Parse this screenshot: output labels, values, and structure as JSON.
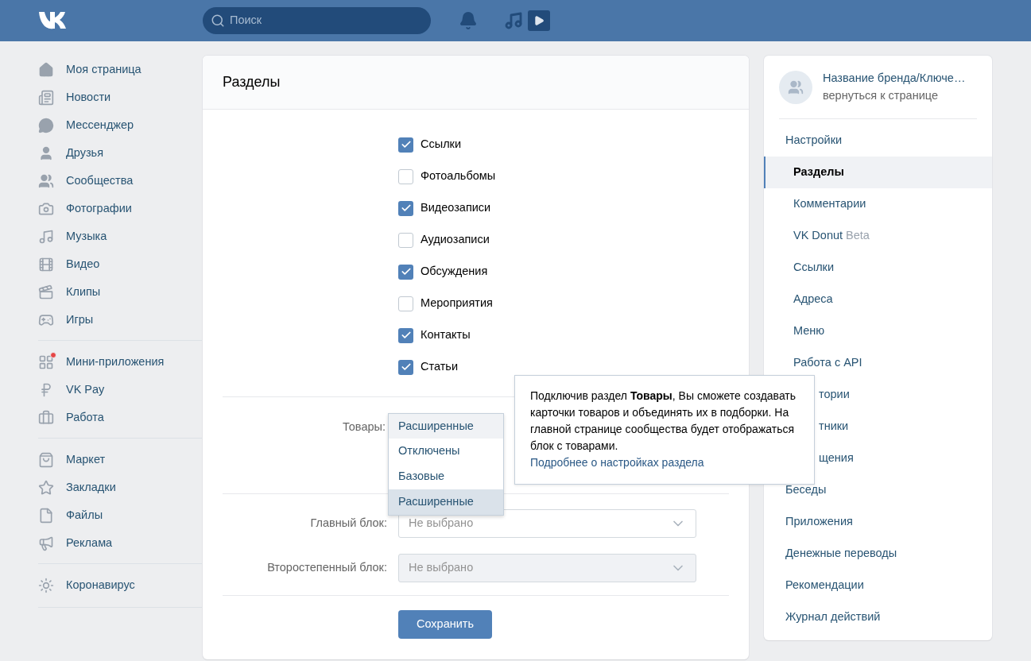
{
  "header": {
    "search": {
      "placeholder": "Поиск"
    }
  },
  "nav": [
    [
      {
        "label": "Моя страница"
      },
      {
        "label": "Новости"
      },
      {
        "label": "Мессенджер"
      },
      {
        "label": "Друзья"
      },
      {
        "label": "Сообщества"
      },
      {
        "label": "Фотографии"
      },
      {
        "label": "Музыка"
      },
      {
        "label": "Видео"
      },
      {
        "label": "Клипы"
      },
      {
        "label": "Игры"
      }
    ],
    [
      {
        "label": "Мини-приложения",
        "notification": true
      },
      {
        "label": "VK Pay",
        "notification": false
      },
      {
        "label": "Работа",
        "notification": false
      }
    ],
    [
      {
        "label": "Маркет"
      },
      {
        "label": "Закладки"
      },
      {
        "label": "Файлы"
      },
      {
        "label": "Реклама"
      }
    ],
    [
      {
        "label": "Коронавирус"
      }
    ]
  ],
  "main": {
    "title": "Разделы",
    "sections": [
      {
        "label": "Ссылки",
        "checked": true
      },
      {
        "label": "Фотоальбомы",
        "checked": false
      },
      {
        "label": "Видеозаписи",
        "checked": true
      },
      {
        "label": "Аудиозаписи",
        "checked": false
      },
      {
        "label": "Обсуждения",
        "checked": true
      },
      {
        "label": "Мероприятия",
        "checked": false
      },
      {
        "label": "Контакты",
        "checked": true
      },
      {
        "label": "Статьи",
        "checked": true
      }
    ],
    "goods": {
      "label": "Товары:",
      "value": "Расширенные",
      "expanded": true,
      "options": [
        {
          "label": "Отключены",
          "selected": false
        },
        {
          "label": "Базовые",
          "selected": false
        },
        {
          "label": "Расширенные",
          "selected": true
        }
      ]
    },
    "tooltip": {
      "text": "Подключив раздел **Товары**, Вы сможете создавать карточки товаров и объединять их в подборки. На главной странице сообщества будет отображаться блок с товарами.",
      "link": "Подробнее о настройках раздела"
    },
    "blocks": [
      {
        "label": "Главный блок:",
        "placeholder": "Не выбрано",
        "disabled": false
      },
      {
        "label": "Второстепенный блок:",
        "placeholder": "Не выбрано",
        "disabled": true
      }
    ],
    "save": "Сохранить"
  },
  "side": {
    "brand": {
      "name": "Название бренда/Ключе…",
      "link": "вернуться к странице"
    },
    "menu": [
      {
        "label": "Настройки",
        "children": [
          {
            "label": "Разделы",
            "selected": true
          },
          {
            "label": "Комментарии",
            "selected": false
          },
          {
            "label": "VK Donut",
            "badge": "Beta",
            "selected": false
          },
          {
            "label": "Ссылки",
            "selected": false
          },
          {
            "label": "Адреса",
            "selected": false
          },
          {
            "label": "Меню",
            "selected": false
          },
          {
            "label": "Работа с API",
            "selected": false
          },
          {
            "label": "тории",
            "kind": "covered",
            "selected": false
          },
          {
            "label": "тники",
            "kind": "covered",
            "selected": false
          },
          {
            "label": "щения",
            "kind": "covered",
            "selected": false
          }
        ]
      },
      {
        "label": "Беседы"
      },
      {
        "label": "Приложения"
      },
      {
        "label": "Денежные переводы"
      },
      {
        "label": "Рекомендации"
      },
      {
        "label": "Журнал действий"
      }
    ]
  }
}
